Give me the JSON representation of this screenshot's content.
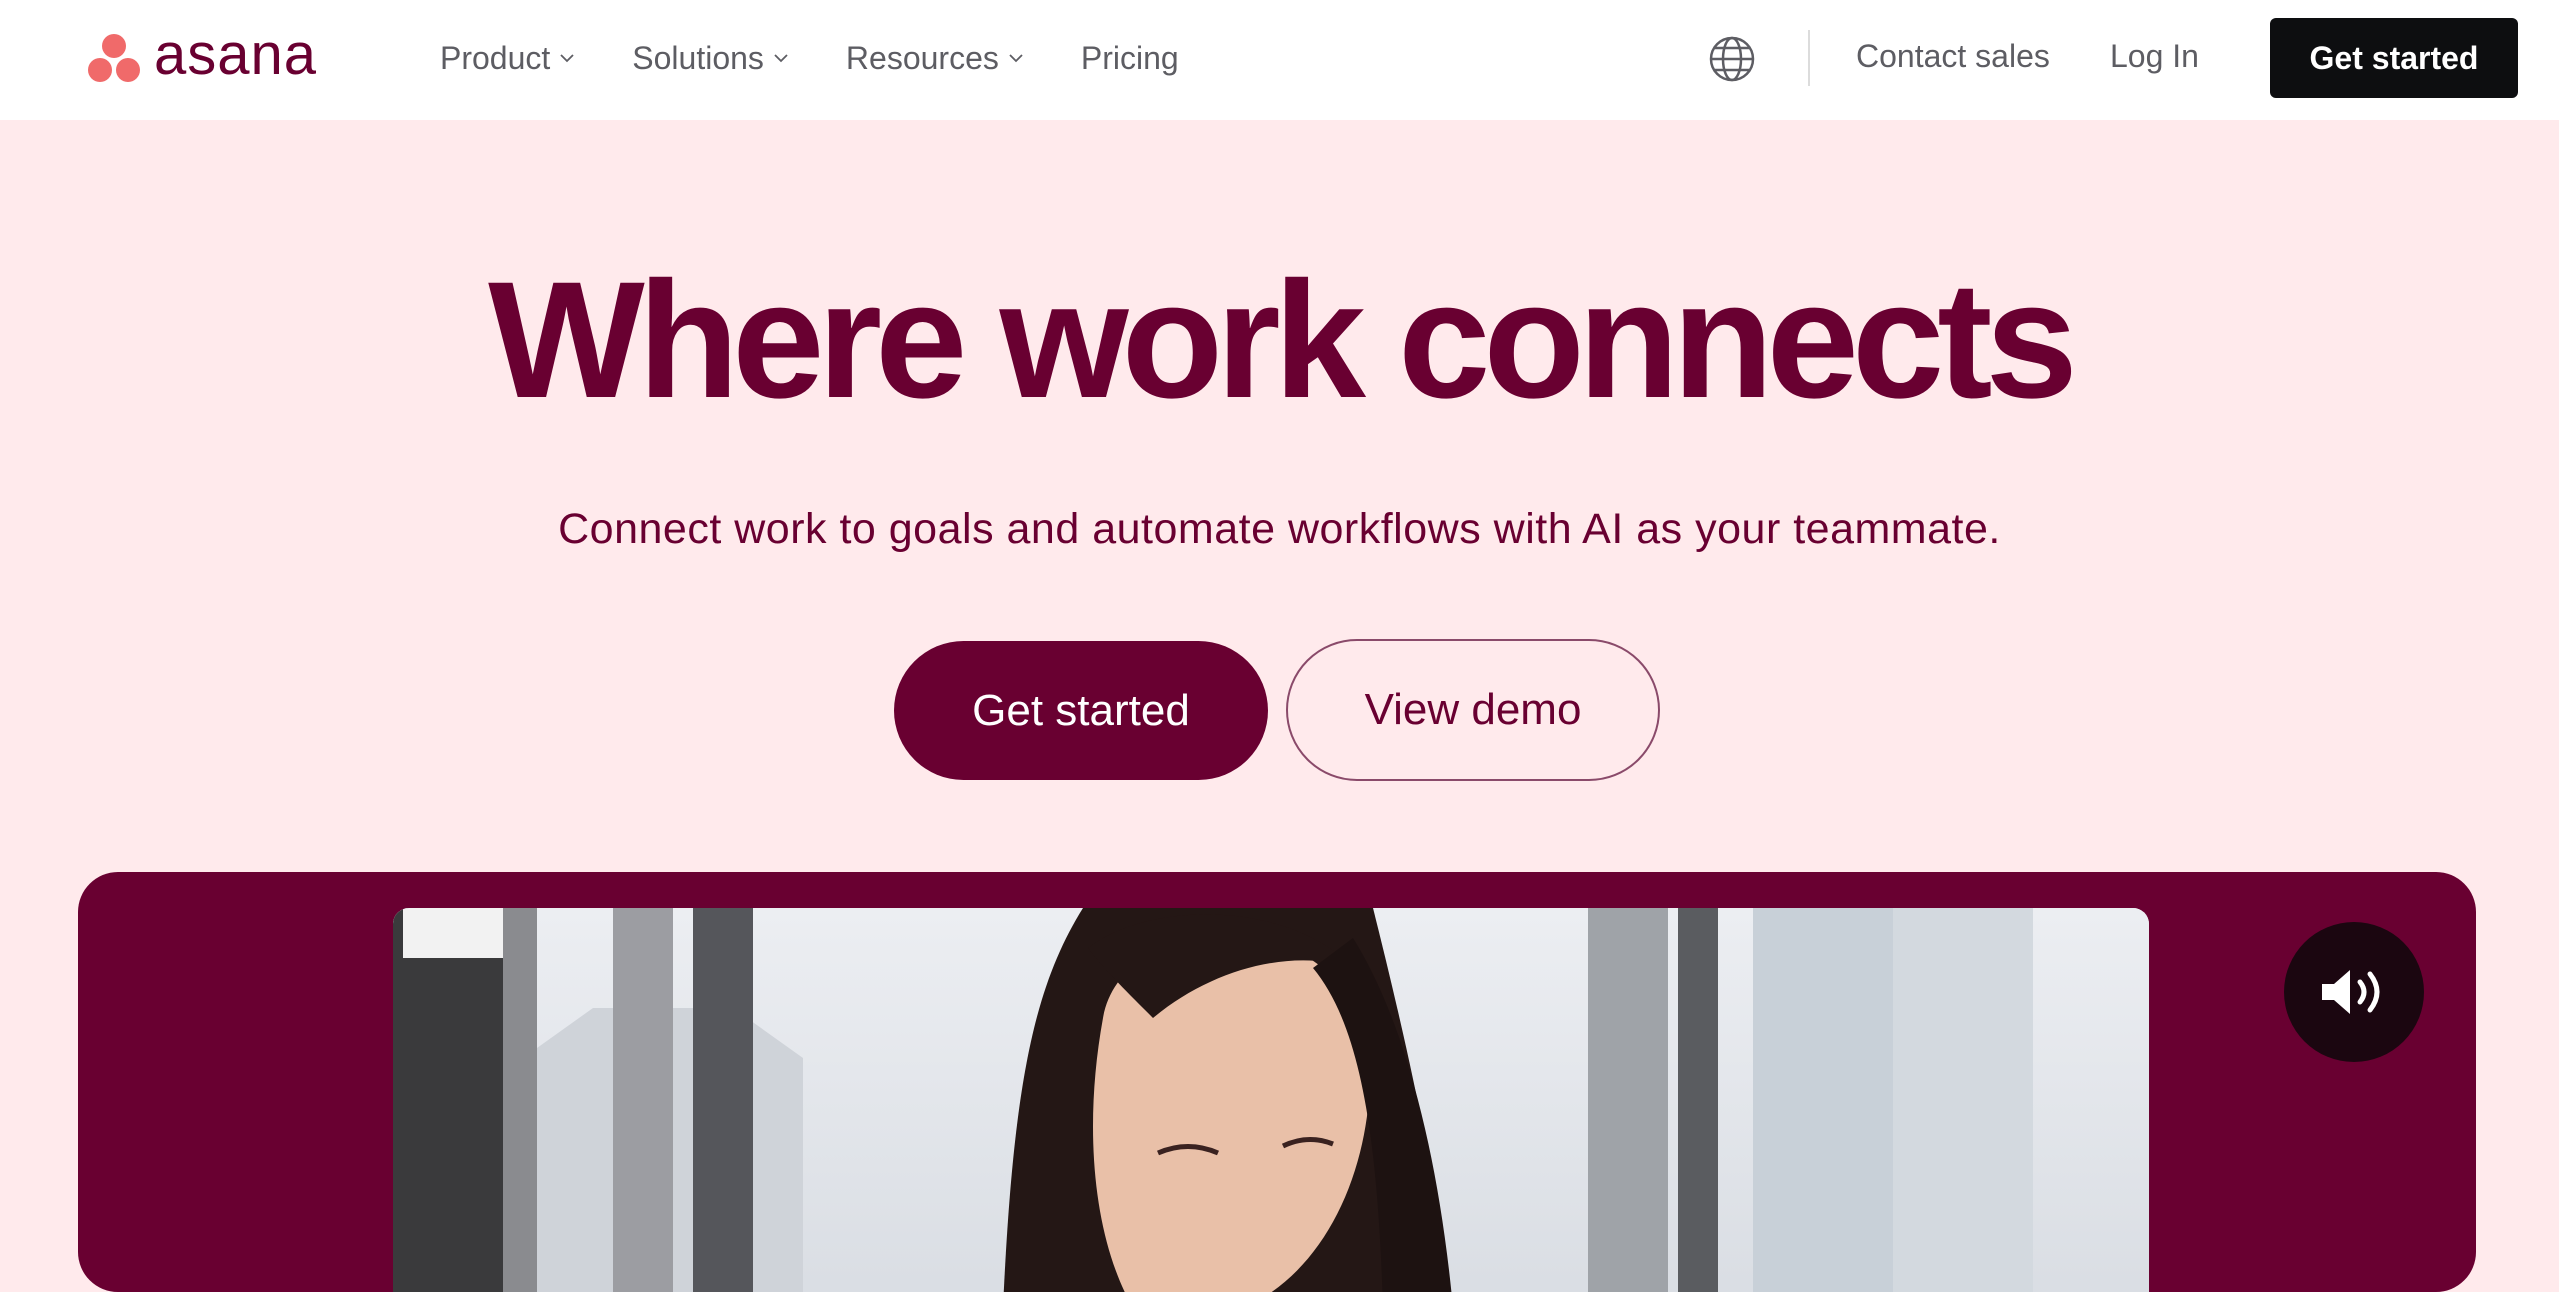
{
  "brand": {
    "name": "asana",
    "colors": {
      "primary": "#690031",
      "accent": "#f06a6a",
      "background": "#ffeaec",
      "dark": "#0d0e10"
    }
  },
  "nav": {
    "items": [
      {
        "label": "Product",
        "has_dropdown": true
      },
      {
        "label": "Solutions",
        "has_dropdown": true
      },
      {
        "label": "Resources",
        "has_dropdown": true
      },
      {
        "label": "Pricing",
        "has_dropdown": false
      }
    ],
    "globe_icon": "globe-icon",
    "contact_sales": "Contact sales",
    "login": "Log In",
    "cta": "Get started"
  },
  "hero": {
    "title": "Where work connects",
    "subtitle": "Connect work to goals and automate workflows with AI as your teammate.",
    "primary_button": "Get started",
    "secondary_button": "View demo"
  },
  "media": {
    "sound_icon": "speaker-volume-icon"
  }
}
